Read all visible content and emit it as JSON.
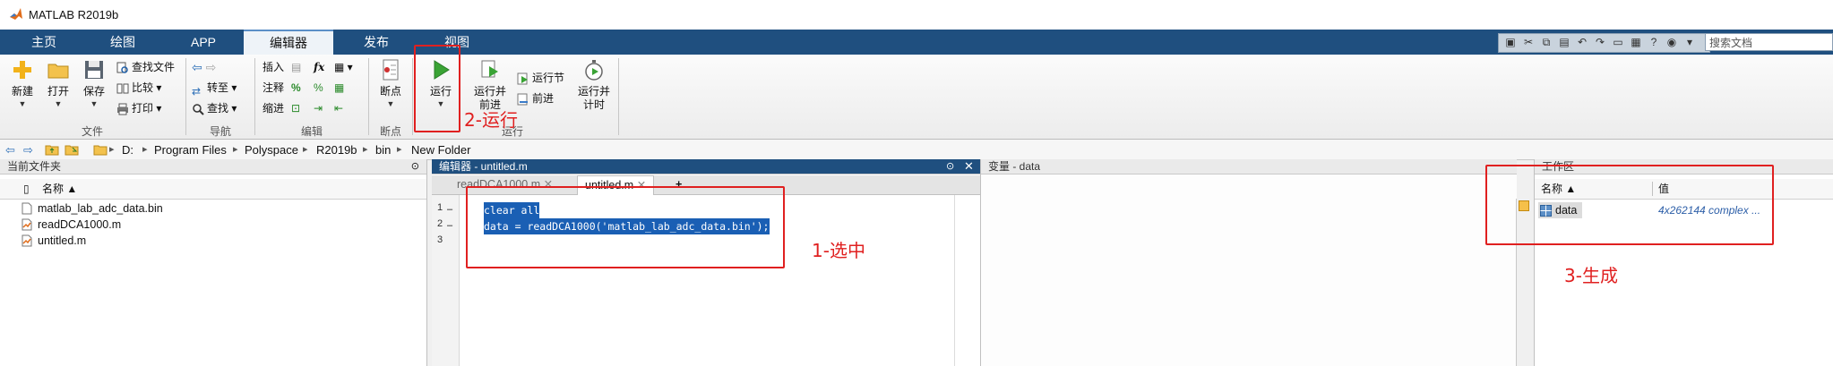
{
  "app": {
    "title": "MATLAB R2019b"
  },
  "tabs": [
    {
      "label": "主页"
    },
    {
      "label": "绘图"
    },
    {
      "label": "APP"
    },
    {
      "label": "编辑器"
    },
    {
      "label": "发布"
    },
    {
      "label": "视图"
    }
  ],
  "search": {
    "placeholder": "搜索文档"
  },
  "ribbon": {
    "file": {
      "new": "新建",
      "open": "打开",
      "save": "保存",
      "find_files": "查找文件",
      "compare": "比较",
      "print": "打印",
      "group": "文件"
    },
    "navigate": {
      "goto": "转至",
      "find": "查找",
      "group": "导航"
    },
    "edit": {
      "insert": "插入",
      "comment": "注释",
      "indent": "缩进",
      "fx": "fx",
      "percent": "%",
      "group": "编辑"
    },
    "breakpoints": {
      "breakpoints": "断点",
      "group": "断点"
    },
    "run": {
      "run": "运行",
      "run_advance_1": "运行并",
      "run_advance_2": "前进",
      "run_section": "运行节",
      "advance": "前进",
      "run_time_1": "运行并",
      "run_time_2": "计时",
      "group": "运行"
    }
  },
  "path": {
    "crumbs": [
      "D:",
      "Program Files",
      "Polyspace",
      "R2019b",
      "bin",
      "New Folder"
    ]
  },
  "current_folder": {
    "title": "当前文件夹",
    "col_name": "名称 ▲",
    "files": [
      "matlab_lab_adc_data.bin",
      "readDCA1000.m",
      "untitled.m"
    ]
  },
  "editor": {
    "title": "编辑器 - untitled.m",
    "variables_title": "变量 - data",
    "tabs": [
      "readDCA1000.m",
      "untitled.m",
      "+"
    ],
    "line_numbers": [
      "1",
      "2",
      "3"
    ],
    "markers": [
      "–",
      "–"
    ],
    "lines": [
      "clear all",
      "data = readDCA1000('matlab_lab_adc_data.bin');",
      ""
    ]
  },
  "workspace": {
    "title": "工作区",
    "col_name": "名称 ▲",
    "col_value": "值",
    "vars": [
      {
        "name": "data",
        "value": "4x262144 complex ..."
      }
    ]
  },
  "annotations": {
    "a1": "1-选中",
    "a2": "2-运行",
    "a3": "3-生成"
  },
  "colors": {
    "ribbon_tab_bg": "#1f4f7f",
    "selection": "#1a5fb4",
    "annotation": "#e02020",
    "run_green": "#3aa335"
  }
}
